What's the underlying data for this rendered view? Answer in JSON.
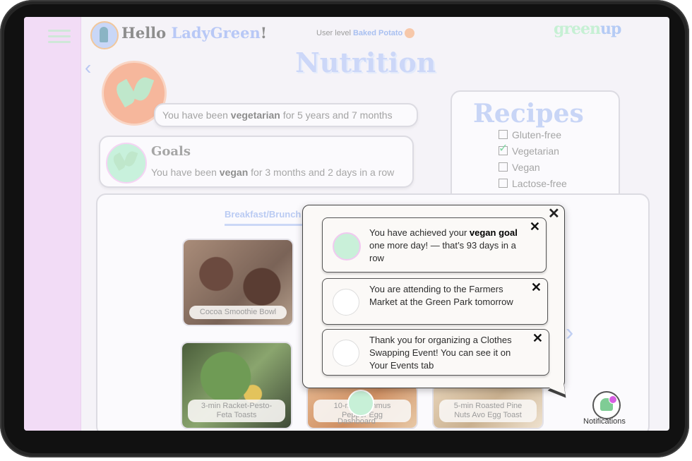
{
  "header": {
    "greeting": "Hello ",
    "user_name": "LadyGreen",
    "greeting_end": "!",
    "user_level_label": "User level ",
    "user_level_value": "Baked Potato",
    "brand_green": "green",
    "brand_up": "up"
  },
  "page": {
    "title": "Nutrition",
    "vegetarian_pre": "You have been ",
    "vegetarian_bold": "vegetarian",
    "vegetarian_post": " for 5 years and 7 months"
  },
  "goals": {
    "title": "Goals",
    "text_pre": "You have been ",
    "text_bold": "vegan",
    "text_post": " for 3 months and 2 days in a row"
  },
  "recipes": {
    "title": "Recipes",
    "filters": [
      {
        "label": "Gluten-free",
        "checked": false
      },
      {
        "label": "Vegetarian",
        "checked": true
      },
      {
        "label": "Vegan",
        "checked": false
      },
      {
        "label": "Lactose-free",
        "checked": false
      }
    ]
  },
  "menu": {
    "tab": "Breakfast/Brunch",
    "items": [
      {
        "label": "Cocoa Smoothie Bowl"
      },
      {
        "label": "3-min Racket-Pesto-\nFeta Toasts"
      },
      {
        "label": "10-min Hummus\nPepper Egg"
      },
      {
        "label": "5-min Roasted Pine\nNuts Avo Egg Toast"
      }
    ]
  },
  "bottom_nav": {
    "dashboard": "Dashboard",
    "notifications": "Notifications"
  },
  "notifications": [
    {
      "pre": "You  have achieved your ",
      "bold1": "vegan",
      "mid": " ",
      "bold2": "goal",
      "post": " one more day! — that’s 93 days in a row"
    },
    {
      "pre": "You are attending to the Farmers Market at the Green Park tomorrow",
      "bold1": "",
      "mid": "",
      "bold2": "",
      "post": ""
    },
    {
      "pre": "Thank you for organizing a Clothes Swapping Event! You  can see it on Your Events  tab",
      "bold1": "",
      "mid": "",
      "bold2": "",
      "post": ""
    }
  ],
  "colors": {
    "sidebar": "#f2dcf6",
    "accent_blue": "#c8d5f6",
    "accent_green": "#c7f0d7"
  }
}
